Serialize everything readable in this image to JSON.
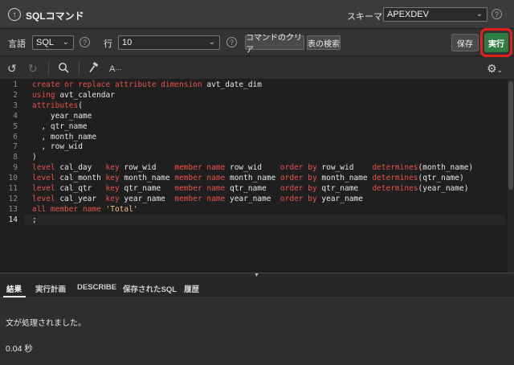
{
  "header": {
    "title": "SQLコマンド",
    "schema_label": "スキーマ",
    "schema_value": "APEXDEV",
    "help": "?"
  },
  "toolbar": {
    "language_label": "言語",
    "language_value": "SQL",
    "rows_label": "行",
    "rows_value": "10",
    "help": "?",
    "clear_label": "コマンドのクリア",
    "find_tables_label": "表の検索",
    "save_label": "保存",
    "run_label": "実行"
  },
  "editor_toolbar": {
    "undo_icon": "undo-icon",
    "redo_icon": "redo-icon",
    "search_icon": "search-icon",
    "format_icon": "hammer-icon",
    "autocomplete_label": "A",
    "settings_icon": "gear-icon"
  },
  "editor": {
    "line_numbers": [
      "1",
      "2",
      "3",
      "4",
      "5",
      "6",
      "7",
      "8",
      "9",
      "10",
      "11",
      "12",
      "13",
      "14"
    ],
    "lines": [
      [
        {
          "t": "create or replace attribute dimension",
          "k": true
        },
        {
          "t": " avt_date_dim"
        }
      ],
      [
        {
          "t": "using",
          "k": true
        },
        {
          "t": " avt_calendar"
        }
      ],
      [
        {
          "t": "attributes",
          "k": true
        },
        {
          "t": "("
        }
      ],
      [
        {
          "t": "    year_name"
        }
      ],
      [
        {
          "t": "  , qtr_name"
        }
      ],
      [
        {
          "t": "  , month_name"
        }
      ],
      [
        {
          "t": "  , row_wid"
        }
      ],
      [
        {
          "t": ")"
        }
      ],
      [
        {
          "t": "level",
          "k": true
        },
        {
          "t": " cal_day   "
        },
        {
          "t": "key",
          "k": true
        },
        {
          "t": " row_wid    "
        },
        {
          "t": "member name",
          "k": true
        },
        {
          "t": " row_wid    "
        },
        {
          "t": "order by",
          "k": true
        },
        {
          "t": " row_wid    "
        },
        {
          "t": "determines",
          "k": true
        },
        {
          "t": "(month_name)"
        }
      ],
      [
        {
          "t": "level",
          "k": true
        },
        {
          "t": " cal_month "
        },
        {
          "t": "key",
          "k": true
        },
        {
          "t": " month_name "
        },
        {
          "t": "member name",
          "k": true
        },
        {
          "t": " month_name "
        },
        {
          "t": "order by",
          "k": true
        },
        {
          "t": " month_name "
        },
        {
          "t": "determines",
          "k": true
        },
        {
          "t": "(qtr_name)"
        }
      ],
      [
        {
          "t": "level",
          "k": true
        },
        {
          "t": " cal_qtr   "
        },
        {
          "t": "key",
          "k": true
        },
        {
          "t": " qtr_name   "
        },
        {
          "t": "member name",
          "k": true
        },
        {
          "t": " qtr_name   "
        },
        {
          "t": "order by",
          "k": true
        },
        {
          "t": " qtr_name   "
        },
        {
          "t": "determines",
          "k": true
        },
        {
          "t": "(year_name)"
        }
      ],
      [
        {
          "t": "level",
          "k": true
        },
        {
          "t": " cal_year  "
        },
        {
          "t": "key",
          "k": true
        },
        {
          "t": " year_name  "
        },
        {
          "t": "member name",
          "k": true
        },
        {
          "t": " year_name  "
        },
        {
          "t": "order by",
          "k": true
        },
        {
          "t": " year_name"
        }
      ],
      [
        {
          "t": "all member name",
          "k": true
        },
        {
          "t": " "
        },
        {
          "t": "'Total'",
          "s": true
        }
      ],
      [
        {
          "t": ";"
        }
      ]
    ]
  },
  "result_tabs": [
    {
      "label": "結果",
      "active": true
    },
    {
      "label": "実行計画"
    },
    {
      "label": "DESCRIBE"
    },
    {
      "label": "保存されたSQL"
    },
    {
      "label": "履歴"
    }
  ],
  "result": {
    "message": "文が処理されました。",
    "elapsed": "0.04 秒"
  }
}
